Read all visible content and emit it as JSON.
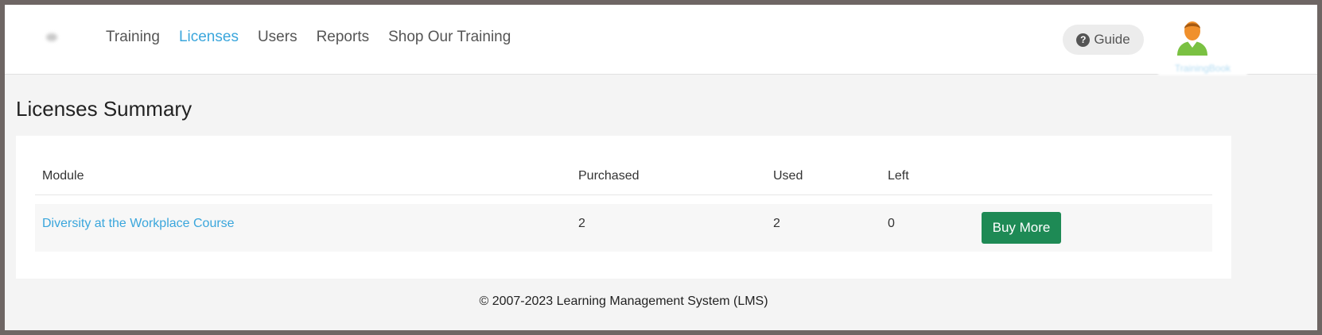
{
  "nav": {
    "items": [
      {
        "label": "Training",
        "active": false
      },
      {
        "label": "Licenses",
        "active": true
      },
      {
        "label": "Users",
        "active": false
      },
      {
        "label": "Reports",
        "active": false
      },
      {
        "label": "Shop Our Training",
        "active": false
      }
    ]
  },
  "header": {
    "guide_label": "Guide",
    "guide_icon": "?",
    "user_name": "TrainingBook"
  },
  "main": {
    "title": "Licenses Summary",
    "table": {
      "columns": [
        "Module",
        "Purchased",
        "Used",
        "Left"
      ],
      "rows": [
        {
          "module": "Diversity at the Workplace Course",
          "purchased": "2",
          "used": "2",
          "left": "0",
          "action": "Buy More"
        }
      ]
    }
  },
  "footer": {
    "copyright": "© 2007-2023 Learning Management System (LMS)"
  },
  "colors": {
    "accent": "#3aa6dc",
    "button_green": "#1e8a55",
    "background": "#f4f4f4",
    "avatar_body": "#7ac142",
    "avatar_head": "#f0902c"
  }
}
